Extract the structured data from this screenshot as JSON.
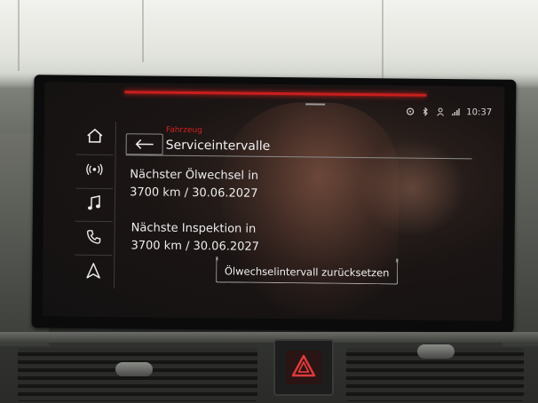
{
  "header": {
    "breadcrumb": "Fahrzeug",
    "title": "Serviceintervalle"
  },
  "status_bar": {
    "time": "10:37",
    "icons": [
      "connect-icon",
      "bluetooth-icon",
      "user-icon",
      "signal-icon"
    ]
  },
  "sidebar": {
    "items": [
      {
        "name": "home-icon"
      },
      {
        "name": "radio-icon"
      },
      {
        "name": "music-icon"
      },
      {
        "name": "phone-icon"
      },
      {
        "name": "navigation-icon"
      }
    ]
  },
  "content": {
    "oil_change_label": "Nächster Ölwechsel in",
    "oil_change_value": "3700 km / 30.06.2027",
    "inspection_label": "Nächste Inspektion in",
    "inspection_value": "3700 km / 30.06.2027",
    "reset_button": "Ölwechselintervall zurücksetzen"
  },
  "colors": {
    "accent": "#d42020",
    "text": "#ececec",
    "background": "#121111"
  }
}
